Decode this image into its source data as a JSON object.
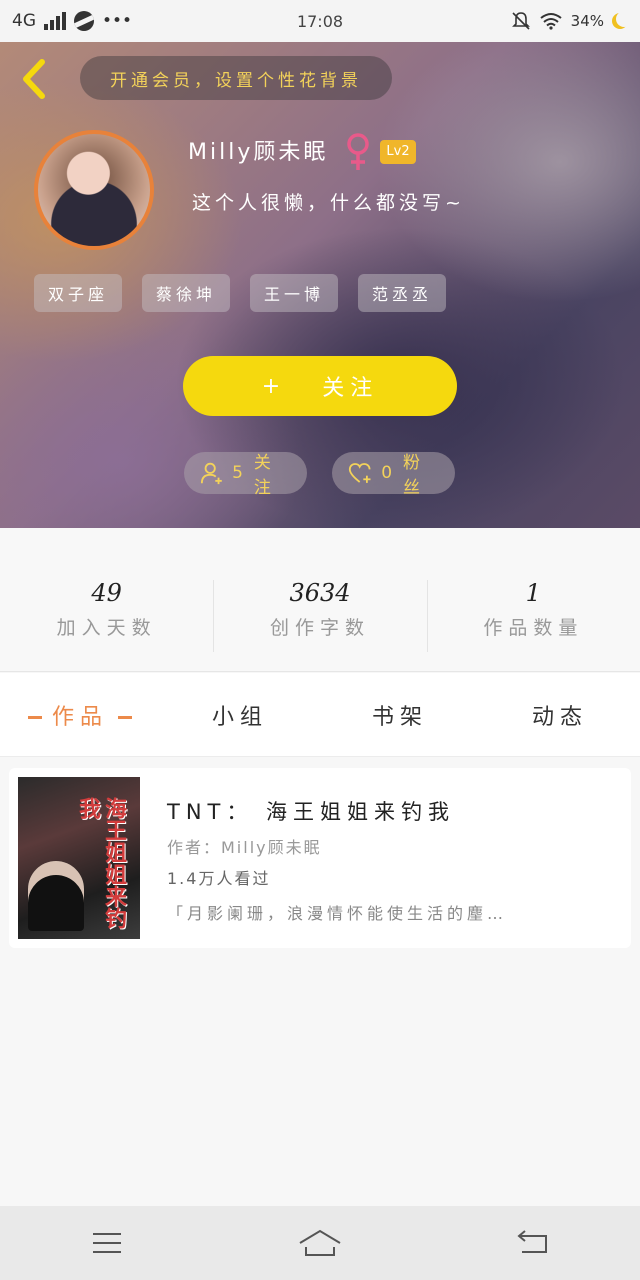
{
  "status_bar": {
    "network": "4G",
    "time": "17:08",
    "battery": "34%",
    "more": "•••"
  },
  "header": {
    "theme_hint": "开通会员，设置个性花背景",
    "username": "Milly顾未眠",
    "gender_icon": "female-icon",
    "level": "Lv2",
    "bio": "这个人很懒，什么都没写~",
    "tags": [
      "双子座",
      "蔡徐坤",
      "王一博",
      "范丞丞"
    ],
    "follow_button": {
      "icon": "+",
      "label": "关注"
    },
    "following": {
      "count": "5",
      "label": "关注"
    },
    "fans": {
      "count": "0",
      "label": "粉丝"
    },
    "colors": {
      "accent_yellow": "#f5d90e",
      "avatar_border": "#e8823a",
      "level_badge": "#f0b62a"
    }
  },
  "stats": [
    {
      "value": "49",
      "label": "加入天数"
    },
    {
      "value": "3634",
      "label": "创作字数"
    },
    {
      "value": "1",
      "label": "作品数量"
    }
  ],
  "tabs": [
    {
      "label": "作品",
      "active": true
    },
    {
      "label": "小组"
    },
    {
      "label": "书架"
    },
    {
      "label": "动态"
    }
  ],
  "book": {
    "title": "TNT： 海王姐姐来钓我",
    "author": "作者：Milly顾未眠",
    "views": "1.4万人看过",
    "excerpt": "「月影阑珊，浪漫情怀能使生活的麈…",
    "cover_text": "海王姐姐来钓我"
  },
  "nav": [
    "menu-icon",
    "home-icon",
    "back-icon"
  ]
}
